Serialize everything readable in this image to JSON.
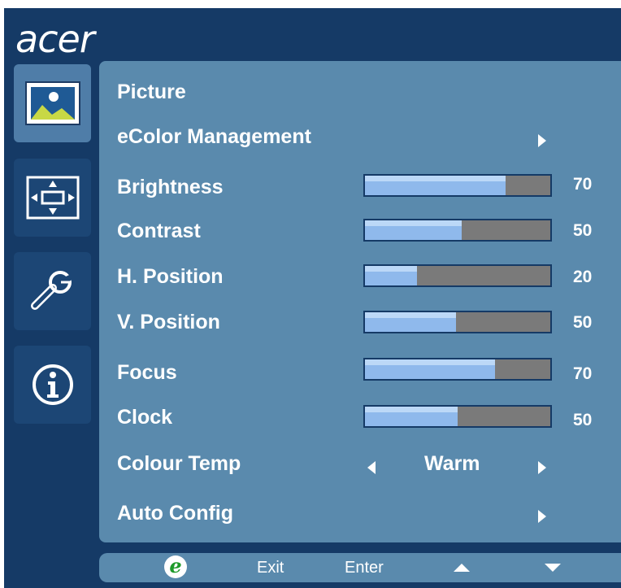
{
  "brand": "acer",
  "sidebar": {
    "tabs": [
      {
        "icon": "picture-icon",
        "active": true
      },
      {
        "icon": "screen-position-icon",
        "active": false
      },
      {
        "icon": "wrench-settings-icon",
        "active": false
      },
      {
        "icon": "info-icon",
        "active": false
      }
    ]
  },
  "menu": {
    "title": "Picture",
    "ecolor": {
      "label": "eColor Management",
      "icon": "arrow-right-icon"
    },
    "sliders": [
      {
        "label": "Brightness",
        "value": 70,
        "max": 100
      },
      {
        "label": "Contrast",
        "value": 50,
        "max": 100
      },
      {
        "label": "H. Position",
        "value": 20,
        "max": 100
      },
      {
        "label": "V. Position",
        "value": 50,
        "max": 100
      },
      {
        "label": "Focus",
        "value": 70,
        "max": 100
      },
      {
        "label": "Clock",
        "value": 50,
        "max": 100
      }
    ],
    "colour_temp": {
      "label": "Colour Temp",
      "value": "Warm"
    },
    "auto_config": {
      "label": "Auto Config"
    }
  },
  "footer": {
    "e_logo": "e",
    "exit_label": "Exit",
    "enter_label": "Enter",
    "up_icon": "triangle-up-icon",
    "down_icon": "triangle-down-icon"
  },
  "colors": {
    "background": "#153a66",
    "panel": "#5a8aad",
    "active_tab": "#4f7da8",
    "bar_fill": "#8fb9ec",
    "bar_track": "#7a7a7a",
    "e_logo": "#1e9a2a"
  }
}
